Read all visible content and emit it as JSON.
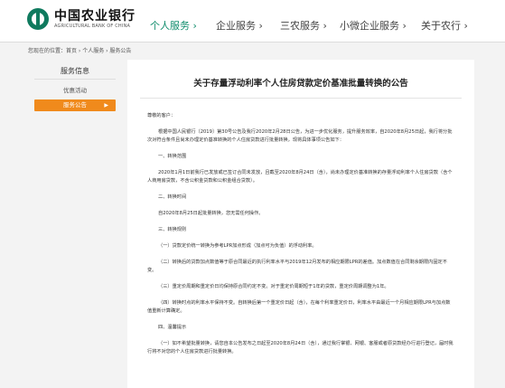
{
  "header": {
    "logo_cn": "中国农业银行",
    "logo_en": "AGRICULTURAL BANK OF CHINA",
    "nav": [
      {
        "label": "个人服务 ›",
        "active": true
      },
      {
        "label": "企业服务 ›",
        "active": false
      },
      {
        "label": "三农服务 ›",
        "active": false
      },
      {
        "label": "小微企业服务 ›",
        "active": false
      },
      {
        "label": "关于农行 ›",
        "active": false
      }
    ]
  },
  "breadcrumb": "您现在的位置：首页 › 个人服务 › 服务公告",
  "sidebar": {
    "title": "服务信息",
    "items": [
      {
        "label": "优惠活动",
        "active": false
      },
      {
        "label": "服务公告",
        "active": true
      }
    ],
    "active_arrow": "▶"
  },
  "article": {
    "title": "关于存量浮动利率个人住房贷款定价基准批量转换的公告",
    "salutation": "尊敬的客户：",
    "intro": "根据中国人民银行〔2019〕第30号公告及我行2020年2月28日公告，为进一步优化服务，提升服务效率，自2020年8月25日起，我行将分批次对符合条件且尚未办理定价基准转换的个人住房贷款进行批量转换，现将具体事项公告如下：",
    "s1_title": "一、转换范围",
    "s1_text": "2020年1月1日前我行已发放或已签订合同未发放，且截至2020年8月24日（含），尚未办理定价基准转换的存量浮动利率个人住房贷款（含个人商用房贷款，不含公积金贷款和公积金组合贷款）。",
    "s2_title": "二、转换时间",
    "s2_text": "自2020年8月25日起批量转换，您无需任何操作。",
    "s3_title": "三、转换规则",
    "s3_p1": "（一）贷款定价统一转换为参考LPR加点形成（加点可为负值）的浮动利率。",
    "s3_p2": "（二）转换后的贷款加点数值等于原合同最近的执行利率水平与2019年12月发布的相应期限LPR的差值。加点数值在合同剩余期限内固定不变。",
    "s3_p3": "（三）重定价周期和重定价日均保持原合同约定不变。对于重定价周期短于1年的贷款，重定价周期调整为1年。",
    "s3_p4": "（四）转换时点的利率水平保持不变。自转换后第一个重定价日起（含），在每个利率重定价日，利率水平由最近一个月相应期限LPR与加点数值重新计算确定。",
    "s4_title": "四、温馨提示",
    "s4_p1": "（一）如不希望批量转换，请您自本公告发布之日起至2020年8月24日（含），通过我行掌银、网银、客服或者原贷款经办行进行登记，届时我行将不对您的个人住房贷款进行批量转换。"
  }
}
